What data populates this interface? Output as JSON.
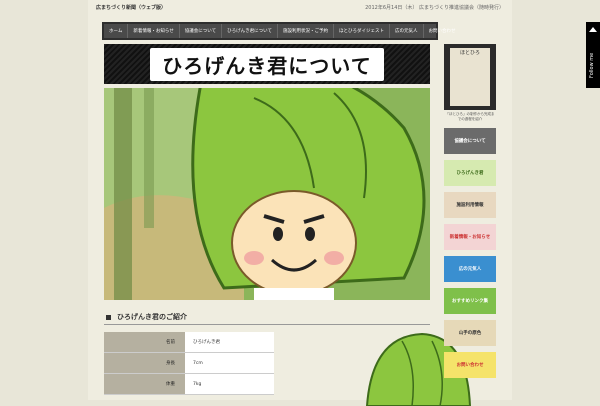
{
  "header": {
    "site_name": "広まちづくり新聞（ウェブ版）",
    "date_line": "2012年6月14日（木） 広まちづくり推進協議会（随時発行）"
  },
  "nav": [
    "ホーム",
    "新着情報・お知らせ",
    "協議会について",
    "ひろげんき君について",
    "施設利用状況・ご予約",
    "ほとひろダイジェスト",
    "広の元気人",
    "お問い合わせ"
  ],
  "hero": {
    "title": "ひろげんき君について"
  },
  "profile": {
    "heading": "ひろげんき君のご紹介",
    "rows": [
      {
        "key": "名前",
        "value": "ひろげんき君"
      },
      {
        "key": "身長",
        "value": "7cm"
      },
      {
        "key": "体重",
        "value": "7kg"
      }
    ]
  },
  "sidebar": {
    "book_label": "ほとひろ",
    "book_caption": "「ほとひろ」の制作から完成までの過程を紹介",
    "buttons": [
      "協議会について",
      "ひろげんき君",
      "施設利用情報",
      "新着情報・お知らせ",
      "広の元気人",
      "おすすめリンク集",
      "山手の原色",
      "お問い合わせ"
    ]
  },
  "follow": {
    "label": "Follow me"
  },
  "colors": {
    "accent_green": "#8cc63f",
    "nav_bg": "#4a4a4a",
    "page_bg": "#efede0"
  }
}
